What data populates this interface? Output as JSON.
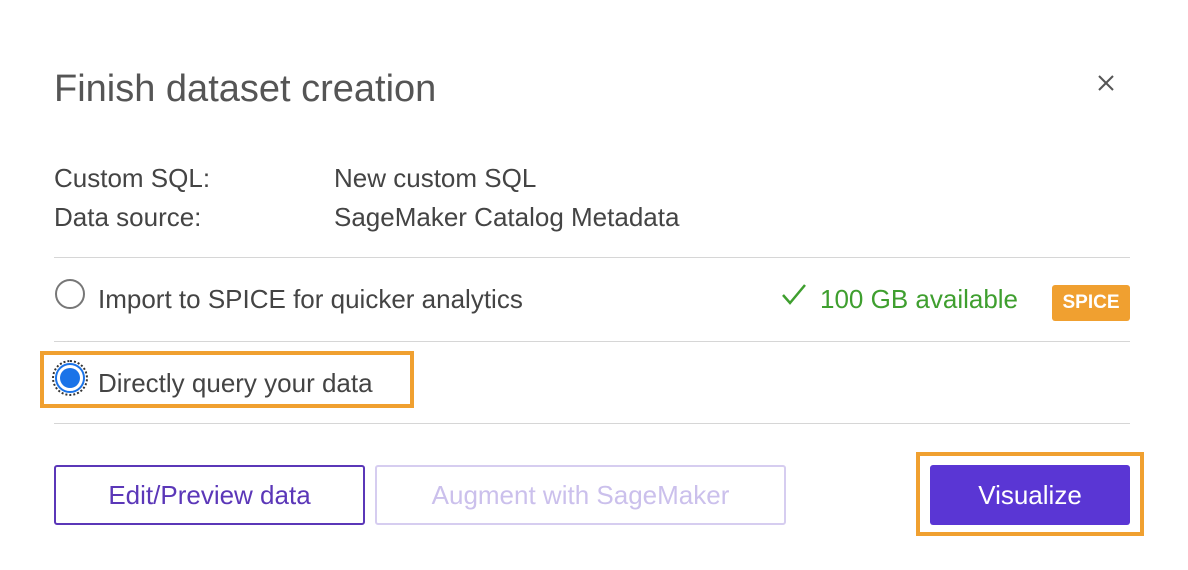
{
  "dialog": {
    "title": "Finish dataset creation",
    "close_icon": "close-icon"
  },
  "details": {
    "custom_sql_label": "Custom SQL:",
    "custom_sql_value": "New custom SQL",
    "data_source_label": "Data source:",
    "data_source_value": "SageMaker Catalog Metadata"
  },
  "query_mode": {
    "options": [
      {
        "label": "Import to SPICE for quicker analytics",
        "selected": false
      },
      {
        "label": "Directly query your data",
        "selected": true
      }
    ],
    "spice_available": "100 GB available",
    "spice_badge": "SPICE"
  },
  "actions": {
    "edit_preview_label": "Edit/Preview data",
    "augment_label": "Augment with SageMaker",
    "visualize_label": "Visualize"
  },
  "colors": {
    "primary": "#5a36d4",
    "success": "#3f9f2f",
    "spice_badge": "#f0a030",
    "highlight": "#f0a030",
    "radio_selected": "#1a73e8"
  }
}
